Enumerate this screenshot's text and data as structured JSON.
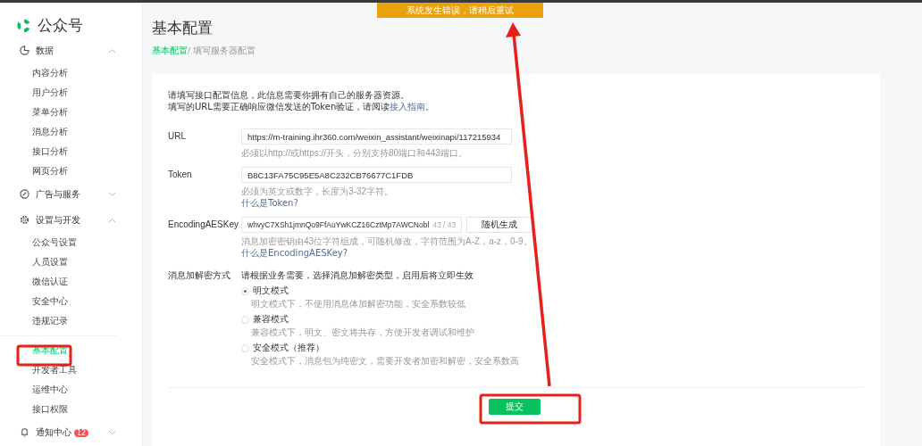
{
  "sidebar": {
    "logo_text": "公众号",
    "groups": [
      {
        "label": "数据",
        "kind": "chart",
        "expanded": true,
        "sections": [
          [
            {
              "label": "内容分析",
              "selected": false
            },
            {
              "label": "用户分析",
              "selected": false
            },
            {
              "label": "菜单分析",
              "selected": false
            },
            {
              "label": "消息分析",
              "selected": false
            },
            {
              "label": "接口分析",
              "selected": false
            },
            {
              "label": "网页分析",
              "selected": false
            }
          ]
        ]
      },
      {
        "label": "广告与服务",
        "kind": "compass",
        "expanded": false
      },
      {
        "label": "设置与开发",
        "kind": "gear",
        "expanded": true,
        "sections": [
          [
            {
              "label": "公众号设置",
              "selected": false
            },
            {
              "label": "人员设置",
              "selected": false
            },
            {
              "label": "微信认证",
              "selected": false
            },
            {
              "label": "安全中心",
              "selected": false
            },
            {
              "label": "违规记录",
              "selected": false
            }
          ],
          [
            {
              "label": "基本配置",
              "selected": true
            },
            {
              "label": "开发者工具",
              "selected": false
            },
            {
              "label": "运维中心",
              "selected": false
            },
            {
              "label": "接口权限",
              "selected": false
            }
          ]
        ]
      },
      {
        "label": "通知中心",
        "kind": "bell",
        "expanded": false,
        "badge": "12"
      }
    ]
  },
  "toast": "系统发生错误，请稍后重试",
  "page": {
    "title": "基本配置",
    "breadcrumb": {
      "parent": "基本配置",
      "current": "/ 填写服务器配置"
    },
    "intro": {
      "line1": "请填写接口配置信息，此信息需要你拥有自己的服务器资源。",
      "line2": "填写的URL需要正确响应微信发送的Token验证，请阅读",
      "link": "接入指南",
      "line2_end": "。"
    },
    "fields": [
      {
        "label": "URL",
        "value": "https://m-training.ihr360.com/weixin_assistant/weixinapi/117215934",
        "hint": "必须以http://或https://开头，分别支持80端口和443端口。"
      },
      {
        "label": "Token",
        "value": "B8C13FA75C95E5A8C232CB76677C1FDB",
        "hint": "必须为英文或数字，长度为3-32字符。",
        "help_link": "什么是Token?"
      },
      {
        "label": "EncodingAESKey",
        "value": "whvyC7XSh1jmnQo9FfAuYwKCZ16CztMp7AWCNobl",
        "counter": "43 / 43",
        "button": "随机生成",
        "hint": "消息加密密钥由43位字符组成，可随机修改，字符范围为A-Z，a-z，0-9。",
        "help_link": "什么是EncodingAESKey?"
      }
    ],
    "encryption": {
      "label": "消息加解密方式",
      "hint": "请根据业务需要，选择消息加解密类型，启用后将立即生效",
      "options": [
        {
          "label": "明文模式",
          "description": "明文模式下，不使用消息体加解密功能，安全系数较低",
          "selected": true
        },
        {
          "label": "兼容模式",
          "description": "兼容模式下，明文、密文将共存，方便开发者调试和维护",
          "selected": false
        },
        {
          "label": "安全模式（推荐）",
          "description": "安全模式下，消息包为纯密文，需要开发者加密和解密，安全系数高",
          "selected": false
        }
      ]
    },
    "submit": "提交"
  }
}
